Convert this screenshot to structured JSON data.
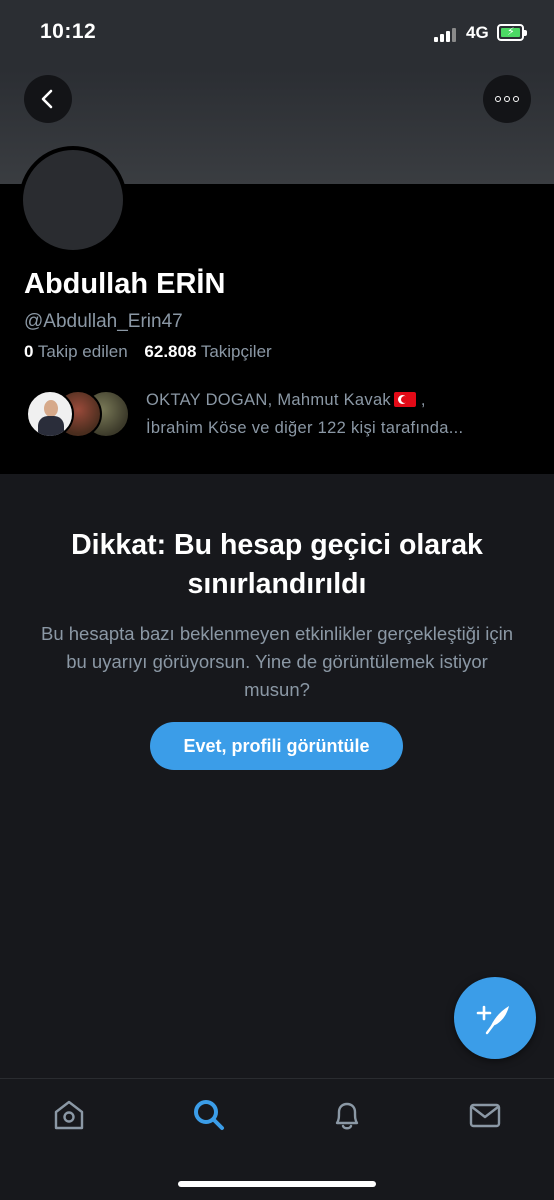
{
  "status_bar": {
    "time": "10:12",
    "network": "4G",
    "battery_icon": "battery-charging-icon",
    "signal_icon": "signal-bars-icon"
  },
  "header": {
    "back_icon": "chevron-left-icon",
    "more_icon": "more-horizontal-icon"
  },
  "profile": {
    "name": "Abdullah ERİN",
    "handle": "@Abdullah_Erin47",
    "following_count": "0",
    "following_label": "Takip edilen",
    "followers_count": "62.808",
    "followers_label": "Takipçiler",
    "followed_by_line1": "OKTAY DOGAN, Mahmut Kavak",
    "followed_by_line1_suffix": " ,",
    "followed_by_line2": "İbrahim Köse ve diğer 122 kişi tarafında..."
  },
  "warning": {
    "title": "Dikkat: Bu hesap geçici olarak sınırlandırıldı",
    "body": "Bu hesapta bazı beklenmeyen etkinlikler gerçekleştiği için bu uyarıyı görüyorsun. Yine de görüntülemek istiyor musun?",
    "button_label": "Evet, profili görüntüle"
  },
  "fab": {
    "icon": "compose-tweet-icon"
  },
  "tabs": [
    {
      "name": "home",
      "icon": "home-icon",
      "active": false
    },
    {
      "name": "search",
      "icon": "search-icon",
      "active": true
    },
    {
      "name": "notifications",
      "icon": "bell-icon",
      "active": false
    },
    {
      "name": "messages",
      "icon": "envelope-icon",
      "active": false
    }
  ],
  "colors": {
    "accent": "#3b9de8",
    "background": "#17181c",
    "secondary_text": "#8b98a5",
    "flag_red": "#e30a17"
  }
}
